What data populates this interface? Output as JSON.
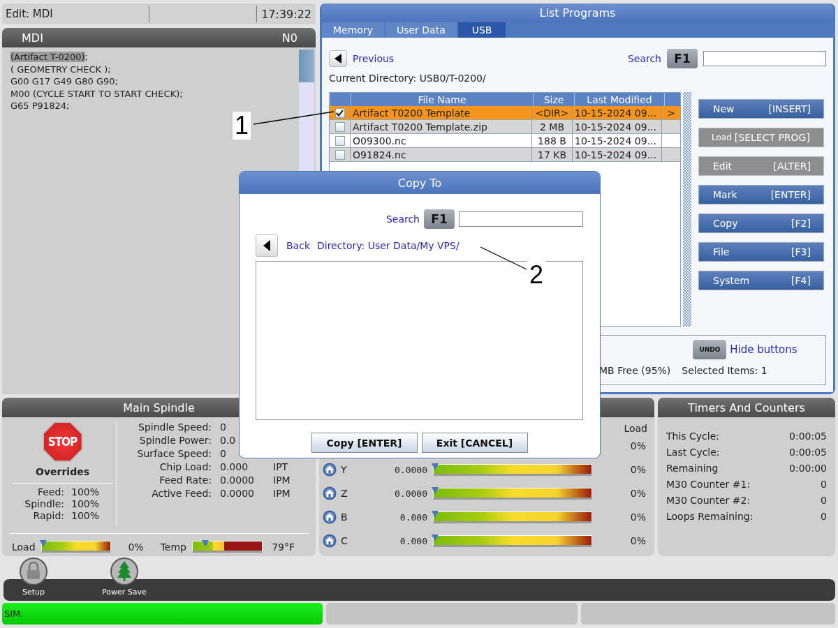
{
  "header": {
    "mode": "Edit: MDI",
    "time": "17:39:22"
  },
  "mdi": {
    "title": "MDI",
    "line_number": "N0",
    "lines": [
      {
        "highlight": "(Artifact T-0200)",
        "text": ";"
      },
      {
        "text": "( GEOMETRY CHECK );"
      },
      {
        "text": "G00 G17 G49 G80 G90;"
      },
      {
        "text": "M00 (CYCLE START TO START CHECK);"
      },
      {
        "text": "G65 P91824;"
      }
    ]
  },
  "list_programs": {
    "title": "List Programs",
    "tabs": [
      {
        "label": "Memory",
        "selected": false
      },
      {
        "label": "User Data",
        "selected": false
      },
      {
        "label": "USB",
        "selected": true
      }
    ],
    "previous": "Previous",
    "search_label": "Search",
    "search_key": "F1",
    "current_directory": "Current Directory: USB0/T-0200/",
    "columns": [
      "File Name",
      "Size",
      "Last Modified"
    ],
    "rows": [
      {
        "checked": true,
        "selected": true,
        "name": "Artifact T0200 Template",
        "size": "<DIR>",
        "modified": "10-15-2024 09...",
        "arrow": ">"
      },
      {
        "checked": false,
        "selected": false,
        "name": "Artifact T0200 Template.zip",
        "size": "2 MB",
        "modified": "10-15-2024 09..."
      },
      {
        "checked": false,
        "selected": false,
        "name": "O09300.nc",
        "size": "188 B",
        "modified": "10-15-2024 09..."
      },
      {
        "checked": false,
        "selected": false,
        "name": "O91824.nc",
        "size": "17 KB",
        "modified": "10-15-2024 09..."
      }
    ],
    "buttons": [
      {
        "label": "New",
        "key": "[INSERT]",
        "disabled": false
      },
      {
        "label": "Load",
        "key": "[SELECT PROG]",
        "disabled": true,
        "kind": "small"
      },
      {
        "label": "Edit",
        "key": "[ALTER]",
        "disabled": true
      },
      {
        "label": "Mark",
        "key": "[ENTER]",
        "disabled": false
      },
      {
        "label": "Copy",
        "key": "[F2]",
        "disabled": false
      },
      {
        "label": "File",
        "key": "[F3]",
        "disabled": false
      },
      {
        "label": "System",
        "key": "[F4]",
        "disabled": false
      }
    ],
    "undo_key": "UNDO",
    "hide_buttons": "Hide buttons",
    "free": "MB Free (95%)",
    "selected_items": "Selected Items: 1"
  },
  "dialog": {
    "title": "Copy To",
    "search_label": "Search",
    "search_key": "F1",
    "back": "Back",
    "directory": "Directory: User Data/My VPS/",
    "buttons": [
      "Copy [ENTER]",
      "Exit  [CANCEL]"
    ]
  },
  "callouts": [
    {
      "label": "1"
    },
    {
      "label": "2"
    }
  ],
  "spindle": {
    "title": "Main Spindle",
    "stop": "STOP",
    "overrides_title": "Overrides",
    "overrides": [
      {
        "label": "Feed:",
        "value": "100%"
      },
      {
        "label": "Spindle:",
        "value": "100%"
      },
      {
        "label": "Rapid:",
        "value": "100%"
      }
    ],
    "readouts": [
      {
        "label": "Spindle Speed:",
        "value": "0"
      },
      {
        "label": "Spindle Power:",
        "value": "0.0"
      },
      {
        "label": "Surface Speed:",
        "value": "0"
      },
      {
        "label": "Chip Load:",
        "value": "0.000",
        "unit": "IPT"
      },
      {
        "label": "Feed Rate:",
        "value": "0.0000",
        "unit": "IPM"
      },
      {
        "label": "Active Feed:",
        "value": "0.0000",
        "unit": "IPM"
      }
    ],
    "meters": [
      {
        "label": "Load",
        "level": 0,
        "reading": "0%",
        "kind": "load"
      },
      {
        "label": "Temp",
        "level": 0.16,
        "reading": "79°F",
        "kind": "temp"
      }
    ]
  },
  "axes": {
    "load_label": "Load",
    "rows": [
      {
        "load": "0%"
      },
      {
        "name": "Y",
        "value": "0.0000",
        "level": 0,
        "load": "0%"
      },
      {
        "name": "Z",
        "value": "0.0000",
        "level": 0,
        "load": "0%"
      },
      {
        "name": "B",
        "value": "0.000",
        "level": 0,
        "load": "0%"
      },
      {
        "name": "C",
        "value": "0.000",
        "level": 0,
        "load": "0%"
      }
    ]
  },
  "timers": {
    "title": "Timers And Counters",
    "rows": [
      {
        "label": "This Cycle:",
        "value": "0:00:05"
      },
      {
        "label": "Last Cycle:",
        "value": "0:00:05"
      },
      {
        "label": "Remaining",
        "value": "0:00:00"
      },
      {
        "label": "M30 Counter #1:",
        "value": "0"
      },
      {
        "label": "M30 Counter #2:",
        "value": "0"
      },
      {
        "label": "Loops Remaining:",
        "value": "0"
      }
    ]
  },
  "toolbar": [
    {
      "label": "Setup",
      "kind": "lock"
    },
    {
      "label": "Power Save",
      "kind": "tree"
    }
  ],
  "status": {
    "text": "SIM:"
  }
}
